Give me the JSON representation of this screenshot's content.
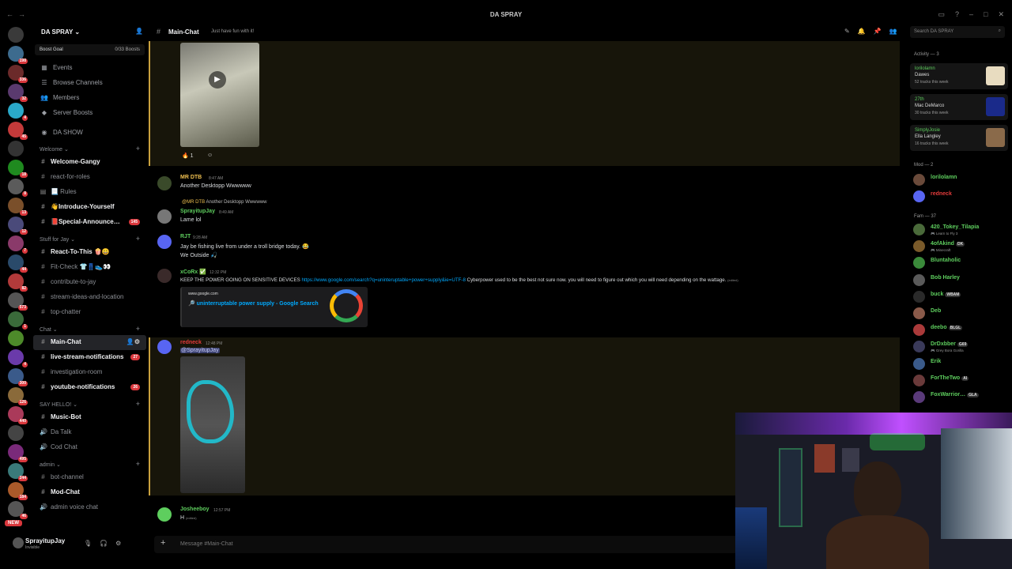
{
  "window": {
    "title": "DA SPRAY"
  },
  "server": {
    "name": "DA SPRAY",
    "boost_goal_label": "Boost Goal",
    "boost_count": "0/33 Boosts"
  },
  "server_rail": [
    {
      "color": "#3d6b8e",
      "badge": "198"
    },
    {
      "color": "#6b2a2a",
      "badge": "336"
    },
    {
      "color": "#5a3a6e",
      "badge": "32"
    },
    {
      "color": "#2aa9c9",
      "badge": "4"
    },
    {
      "color": "#c43a3a",
      "badge": "45"
    },
    {
      "color": "#333333",
      "badge": ""
    },
    {
      "color": "#1f8a1f",
      "badge": "18"
    },
    {
      "color": "#5b5b5b",
      "badge": "8"
    },
    {
      "color": "#7a4f2a",
      "badge": "13"
    },
    {
      "color": "#4a4a7a",
      "badge": "12"
    },
    {
      "color": "#8a3a6a",
      "badge": "7"
    },
    {
      "color": "#2a4a6a",
      "badge": "44"
    },
    {
      "color": "#b23a3a",
      "badge": "82"
    },
    {
      "color": "#555555",
      "badge": "573"
    },
    {
      "color": "#3a6a3a",
      "badge": "1"
    },
    {
      "color": "#4d8a2a",
      "badge": ""
    },
    {
      "color": "#6a3aaa",
      "badge": "4"
    },
    {
      "color": "#3a5a8a",
      "badge": "300"
    },
    {
      "color": "#8a6a3a",
      "badge": "126"
    },
    {
      "color": "#aa3a5a",
      "badge": "440"
    },
    {
      "color": "#444444",
      "badge": ""
    },
    {
      "color": "#7a2a7a",
      "badge": "495"
    },
    {
      "color": "#3a7a7a",
      "badge": "244"
    },
    {
      "color": "#aa5a2a",
      "badge": "184"
    },
    {
      "color": "#555555",
      "badge": "46"
    }
  ],
  "rail_new_label": "NEW",
  "nav": [
    {
      "icon": "calendar-icon",
      "glyph": "▦",
      "label": "Events"
    },
    {
      "icon": "browse-channels-icon",
      "glyph": "☰",
      "label": "Browse Channels"
    },
    {
      "icon": "members-icon",
      "glyph": "👥",
      "label": "Members"
    },
    {
      "icon": "server-boosts-icon",
      "glyph": "◆",
      "label": "Server Boosts"
    }
  ],
  "da_show": "DA SHOW",
  "channels": [
    {
      "type": "cat",
      "label": "Welcome"
    },
    {
      "label": "Welcome-Gangy",
      "bold": true
    },
    {
      "label": "react-for-roles"
    },
    {
      "label": "📃 Rules",
      "glyph": "▤"
    },
    {
      "label": "👋Introduce-Yourself",
      "bold": true
    },
    {
      "label": "📕Special-Announce…",
      "bold": true,
      "badge": "145"
    },
    {
      "type": "cat",
      "label": "Stuff for Jay"
    },
    {
      "label": "React-To-This 🍿😀",
      "bold": true
    },
    {
      "label": "Fit-Check 👕👖👟👀"
    },
    {
      "label": "contribute-to-jay"
    },
    {
      "label": "stream-ideas-and-location"
    },
    {
      "label": "top-chatter"
    },
    {
      "type": "cat",
      "label": "Chat"
    },
    {
      "label": "Main-Chat",
      "selected": true
    },
    {
      "label": "live-stream-notifications",
      "bold": true,
      "badge": "27"
    },
    {
      "label": "investigation-room"
    },
    {
      "label": "youtube-notifications",
      "bold": true,
      "badge": "26"
    },
    {
      "type": "cat",
      "label": "SAY HELLO!"
    },
    {
      "label": "Music-Bot",
      "bold": true
    },
    {
      "label": "Da Talk",
      "glyph": "🔊"
    },
    {
      "label": "Cod Chat",
      "glyph": "🔊"
    },
    {
      "type": "cat",
      "label": "admin"
    },
    {
      "label": "bot-channel"
    },
    {
      "label": "Mod-Chat",
      "bold": true
    },
    {
      "label": "admin voice chat",
      "glyph": "🔊"
    }
  ],
  "user": {
    "name": "SprayitupJay",
    "status": "Invisible"
  },
  "channel_header": {
    "name": "Main-Chat",
    "topic": "Just have fun with it!"
  },
  "search": {
    "placeholder": "Search DA SPRAY"
  },
  "messages": {
    "reaction_count": "1",
    "m1": {
      "author": "MR DTB",
      "time": "8:47 AM",
      "text": "Another Desktopp Wwwwww"
    },
    "m2": {
      "reply_author": "@MR DTB",
      "reply_text": "Another Desktopp Wwwwww",
      "author": "SprayitupJay",
      "time": "8:49 AM",
      "text": "Lame lol"
    },
    "m3": {
      "author": "RJT",
      "time": "9:28 AM",
      "text1": "Jay be fishing live from under a troll bridge today. 😂",
      "text2": "We Outside 🎣"
    },
    "m4": {
      "author": "xCoRx ✅",
      "time": "12:32 PM",
      "text_pre": "KEEP THE POWER GOING ON SENSITIVE DEVICES",
      "link": "https://www.google.com/search?q=uninteruptable+power+supply&ie=UTF-8",
      "text_post": "Cyberpower used to be the best not sure now. you will need to figure out which you will need depending on the wattage.",
      "edited": "(edited)",
      "embed_site": "www.google.com",
      "embed_title": "🔎 uninterruptable power supply - Google Search"
    },
    "m5": {
      "author": "redneck",
      "time": "12:48 PM",
      "mention": "@SprayitupJay"
    },
    "m6": {
      "author": "Josheeboy",
      "time": "12:57 PM",
      "text": "H",
      "edited": "(edited)"
    }
  },
  "composer": {
    "placeholder": "Message #Main-Chat"
  },
  "members": {
    "activity_label": "Activity — 3",
    "activities": [
      {
        "user": "lorilolamn",
        "artist": "Dawes",
        "count": "52 tracks this week",
        "thumb": "#e8dcc0"
      },
      {
        "user": "27th",
        "artist": "Mac DeMarco",
        "count": "30 tracks this week",
        "thumb": "#1a2a8a"
      },
      {
        "user": "SimplyJosie",
        "artist": "Ella Langley",
        "count": "16 tracks this week",
        "thumb": "#8a6a4a"
      }
    ],
    "mod_label": "Mod — 2",
    "mods": [
      {
        "name": "lorilolamn",
        "color": "#5ece5e",
        "av": "#6a4a3a"
      },
      {
        "name": "redneck",
        "color": "#e23b3b",
        "av": "#5865f2"
      }
    ],
    "fam_label": "Fam — 37",
    "fam": [
      {
        "name": "420_Tokey_Tilapia",
        "sub": "🎮 Learn to Fly 3",
        "tag": "",
        "color": "#5ece5e",
        "av": "#4a6a3a"
      },
      {
        "name": "4ofAkind",
        "sub": "🎮 Minecraft",
        "tag": "DK",
        "color": "#5ece5e",
        "av": "#7a5a2a"
      },
      {
        "name": "Bluntaholic",
        "sub": "",
        "tag": "",
        "color": "#5ece5e",
        "av": "#3a8a3a"
      },
      {
        "name": "Bob Harley",
        "sub": "",
        "tag": "",
        "color": "#5ece5e",
        "av": "#5a5a5a"
      },
      {
        "name": "buck",
        "sub": "",
        "tag": "WBAM",
        "color": "#5ece5e",
        "av": "#2a2a2a"
      },
      {
        "name": "Deb",
        "sub": "",
        "tag": "",
        "color": "#5ece5e",
        "av": "#8a5a4a"
      },
      {
        "name": "deebo",
        "sub": "",
        "tag": "BLGL",
        "color": "#5ece5e",
        "av": "#aa3a3a"
      },
      {
        "name": "DrDxbber",
        "sub": "🎮 Grey Bora Gorilla",
        "tag": "G69",
        "color": "#5ece5e",
        "av": "#3a3a5a"
      },
      {
        "name": "Erik",
        "sub": "",
        "tag": "",
        "color": "#5ece5e",
        "av": "#3a5a8a"
      },
      {
        "name": "ForTheTwo",
        "sub": "",
        "tag": "Al",
        "color": "#5ece5e",
        "av": "#6a3a3a"
      },
      {
        "name": "FoxWarrior…",
        "sub": "",
        "tag": "GLA",
        "color": "#5ece5e",
        "av": "#5a3a7a"
      }
    ]
  }
}
